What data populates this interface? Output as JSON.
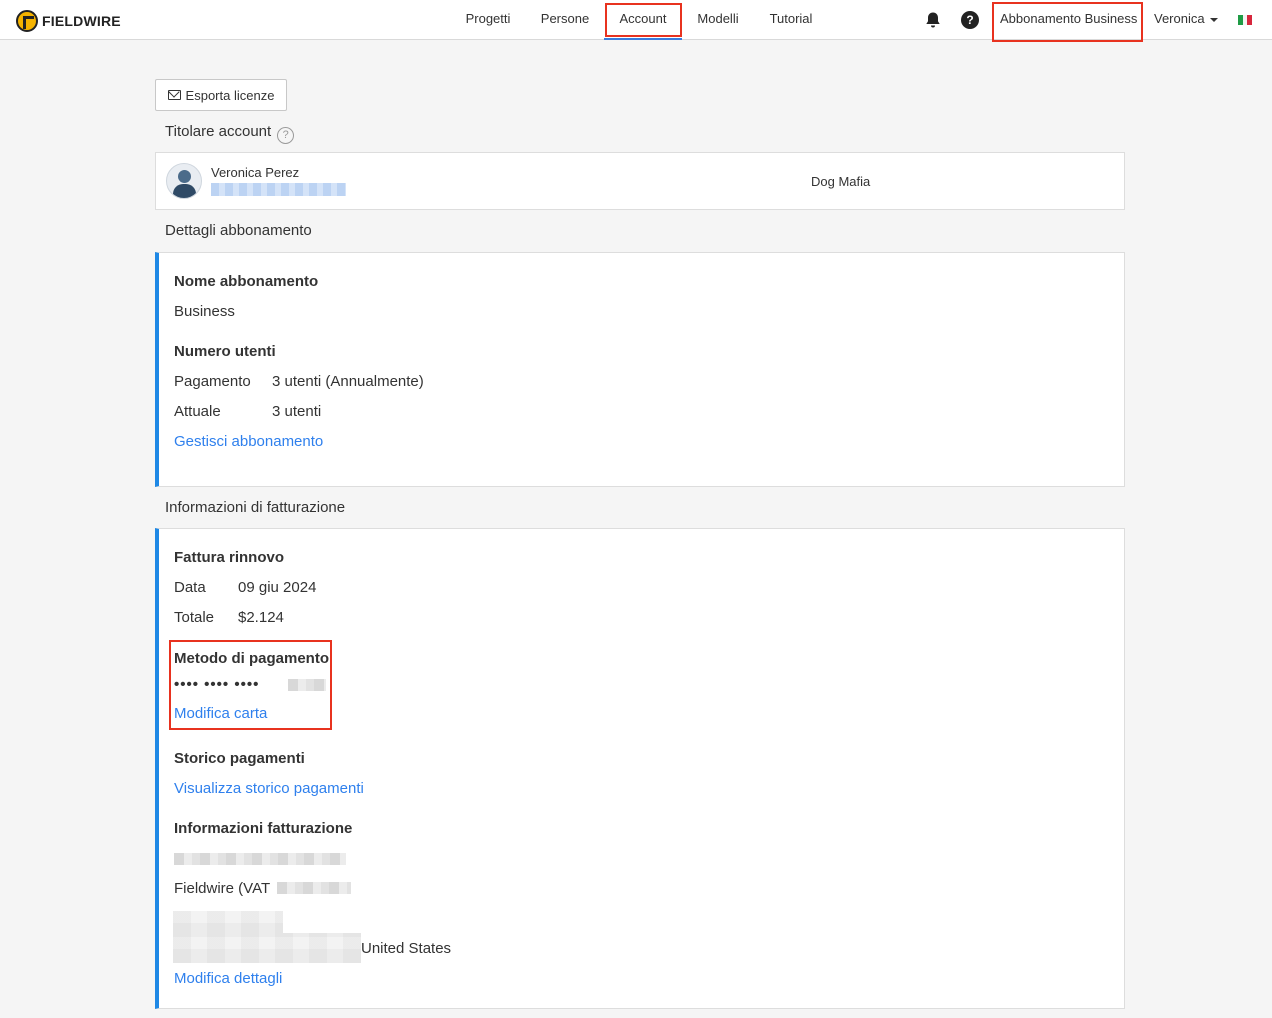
{
  "brand": {
    "name": "FIELDWIRE"
  },
  "nav": {
    "items": [
      {
        "label": "Progetti"
      },
      {
        "label": "Persone"
      },
      {
        "label": "Account"
      },
      {
        "label": "Modelli"
      },
      {
        "label": "Tutorial"
      }
    ],
    "active": "Account"
  },
  "header": {
    "subscription_label": "Abbonamento Business",
    "user_name": "Veronica",
    "language_flag": "it"
  },
  "actions": {
    "export_label": "Esporta licenze"
  },
  "owner_section": {
    "title": "Titolare account",
    "help_glyph": "?",
    "name": "Veronica Perez",
    "company": "Dog Mafia"
  },
  "subscription_section": {
    "title": "Dettagli abbonamento",
    "plan_label": "Nome abbonamento",
    "plan_value": "Business",
    "users_label": "Numero utenti",
    "payment_label": "Pagamento",
    "payment_value": "3 utenti (Annualmente)",
    "current_label": "Attuale",
    "current_value": "3 utenti",
    "manage_link": "Gestisci abbonamento"
  },
  "billing_section": {
    "title": "Informazioni di fatturazione",
    "renewal_label": "Fattura rinnovo",
    "date_label": "Data",
    "date_value": "09 giu 2024",
    "total_label": "Totale",
    "total_value": "$2.124",
    "payment_method_label": "Metodo di pagamento",
    "card_mask": "•••• •••• ••••",
    "edit_card_link": "Modifica carta",
    "history_label": "Storico pagamenti",
    "history_link": "Visualizza storico pagamenti",
    "billing_info_label": "Informazioni fatturazione",
    "company_prefix": "Fieldwire (VAT",
    "country": "United States",
    "edit_details_link": "Modifica dettagli"
  },
  "colors": {
    "accent": "#1e88e5",
    "link": "#2f80ed",
    "highlight": "#e8321f",
    "active_tab": "#3b7ddd"
  }
}
